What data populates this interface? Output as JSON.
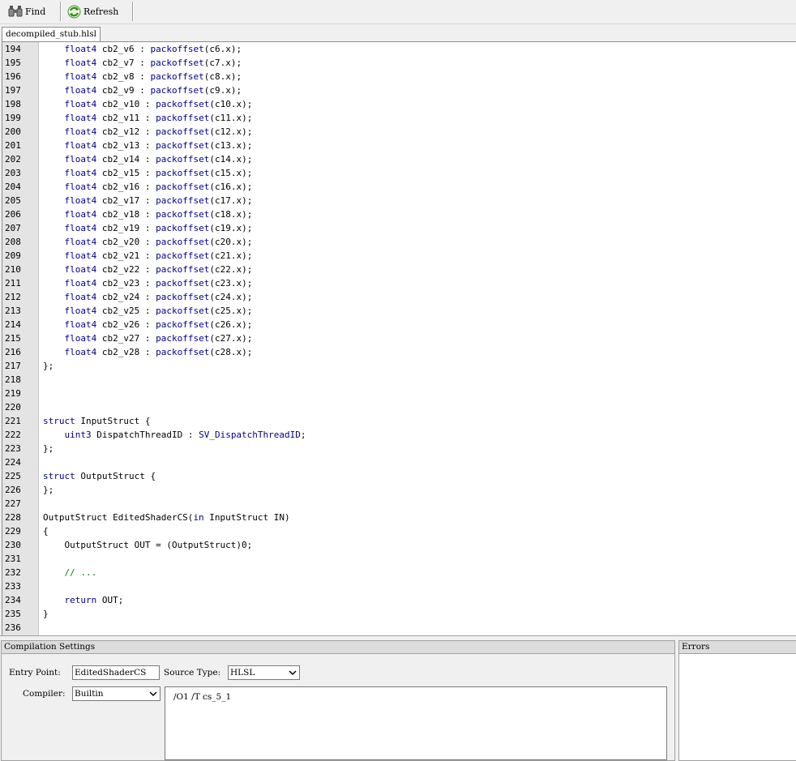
{
  "toolbar": {
    "find_label": "Find",
    "refresh_label": "Refresh"
  },
  "tabs": [
    {
      "label": "decompiled_stub.hlsl"
    }
  ],
  "editor": {
    "lines": [
      {
        "n": "194",
        "parts": [
          {
            "t": "    "
          },
          {
            "t": "float4",
            "c": "kw"
          },
          {
            "t": " cb2_v6 : "
          },
          {
            "t": "packoffset",
            "c": "kw"
          },
          {
            "t": "(c6.x);"
          }
        ]
      },
      {
        "n": "195",
        "parts": [
          {
            "t": "    "
          },
          {
            "t": "float4",
            "c": "kw"
          },
          {
            "t": " cb2_v7 : "
          },
          {
            "t": "packoffset",
            "c": "kw"
          },
          {
            "t": "(c7.x);"
          }
        ]
      },
      {
        "n": "196",
        "parts": [
          {
            "t": "    "
          },
          {
            "t": "float4",
            "c": "kw"
          },
          {
            "t": " cb2_v8 : "
          },
          {
            "t": "packoffset",
            "c": "kw"
          },
          {
            "t": "(c8.x);"
          }
        ]
      },
      {
        "n": "197",
        "parts": [
          {
            "t": "    "
          },
          {
            "t": "float4",
            "c": "kw"
          },
          {
            "t": " cb2_v9 : "
          },
          {
            "t": "packoffset",
            "c": "kw"
          },
          {
            "t": "(c9.x);"
          }
        ]
      },
      {
        "n": "198",
        "parts": [
          {
            "t": "    "
          },
          {
            "t": "float4",
            "c": "kw"
          },
          {
            "t": " cb2_v10 : "
          },
          {
            "t": "packoffset",
            "c": "kw"
          },
          {
            "t": "(c10.x);"
          }
        ]
      },
      {
        "n": "199",
        "parts": [
          {
            "t": "    "
          },
          {
            "t": "float4",
            "c": "kw"
          },
          {
            "t": " cb2_v11 : "
          },
          {
            "t": "packoffset",
            "c": "kw"
          },
          {
            "t": "(c11.x);"
          }
        ]
      },
      {
        "n": "200",
        "parts": [
          {
            "t": "    "
          },
          {
            "t": "float4",
            "c": "kw"
          },
          {
            "t": " cb2_v12 : "
          },
          {
            "t": "packoffset",
            "c": "kw"
          },
          {
            "t": "(c12.x);"
          }
        ]
      },
      {
        "n": "201",
        "parts": [
          {
            "t": "    "
          },
          {
            "t": "float4",
            "c": "kw"
          },
          {
            "t": " cb2_v13 : "
          },
          {
            "t": "packoffset",
            "c": "kw"
          },
          {
            "t": "(c13.x);"
          }
        ]
      },
      {
        "n": "202",
        "parts": [
          {
            "t": "    "
          },
          {
            "t": "float4",
            "c": "kw"
          },
          {
            "t": " cb2_v14 : "
          },
          {
            "t": "packoffset",
            "c": "kw"
          },
          {
            "t": "(c14.x);"
          }
        ]
      },
      {
        "n": "203",
        "parts": [
          {
            "t": "    "
          },
          {
            "t": "float4",
            "c": "kw"
          },
          {
            "t": " cb2_v15 : "
          },
          {
            "t": "packoffset",
            "c": "kw"
          },
          {
            "t": "(c15.x);"
          }
        ]
      },
      {
        "n": "204",
        "parts": [
          {
            "t": "    "
          },
          {
            "t": "float4",
            "c": "kw"
          },
          {
            "t": " cb2_v16 : "
          },
          {
            "t": "packoffset",
            "c": "kw"
          },
          {
            "t": "(c16.x);"
          }
        ]
      },
      {
        "n": "205",
        "parts": [
          {
            "t": "    "
          },
          {
            "t": "float4",
            "c": "kw"
          },
          {
            "t": " cb2_v17 : "
          },
          {
            "t": "packoffset",
            "c": "kw"
          },
          {
            "t": "(c17.x);"
          }
        ]
      },
      {
        "n": "206",
        "parts": [
          {
            "t": "    "
          },
          {
            "t": "float4",
            "c": "kw"
          },
          {
            "t": " cb2_v18 : "
          },
          {
            "t": "packoffset",
            "c": "kw"
          },
          {
            "t": "(c18.x);"
          }
        ]
      },
      {
        "n": "207",
        "parts": [
          {
            "t": "    "
          },
          {
            "t": "float4",
            "c": "kw"
          },
          {
            "t": " cb2_v19 : "
          },
          {
            "t": "packoffset",
            "c": "kw"
          },
          {
            "t": "(c19.x);"
          }
        ]
      },
      {
        "n": "208",
        "parts": [
          {
            "t": "    "
          },
          {
            "t": "float4",
            "c": "kw"
          },
          {
            "t": " cb2_v20 : "
          },
          {
            "t": "packoffset",
            "c": "kw"
          },
          {
            "t": "(c20.x);"
          }
        ]
      },
      {
        "n": "209",
        "parts": [
          {
            "t": "    "
          },
          {
            "t": "float4",
            "c": "kw"
          },
          {
            "t": " cb2_v21 : "
          },
          {
            "t": "packoffset",
            "c": "kw"
          },
          {
            "t": "(c21.x);"
          }
        ]
      },
      {
        "n": "210",
        "parts": [
          {
            "t": "    "
          },
          {
            "t": "float4",
            "c": "kw"
          },
          {
            "t": " cb2_v22 : "
          },
          {
            "t": "packoffset",
            "c": "kw"
          },
          {
            "t": "(c22.x);"
          }
        ]
      },
      {
        "n": "211",
        "parts": [
          {
            "t": "    "
          },
          {
            "t": "float4",
            "c": "kw"
          },
          {
            "t": " cb2_v23 : "
          },
          {
            "t": "packoffset",
            "c": "kw"
          },
          {
            "t": "(c23.x);"
          }
        ]
      },
      {
        "n": "212",
        "parts": [
          {
            "t": "    "
          },
          {
            "t": "float4",
            "c": "kw"
          },
          {
            "t": " cb2_v24 : "
          },
          {
            "t": "packoffset",
            "c": "kw"
          },
          {
            "t": "(c24.x);"
          }
        ]
      },
      {
        "n": "213",
        "parts": [
          {
            "t": "    "
          },
          {
            "t": "float4",
            "c": "kw"
          },
          {
            "t": " cb2_v25 : "
          },
          {
            "t": "packoffset",
            "c": "kw"
          },
          {
            "t": "(c25.x);"
          }
        ]
      },
      {
        "n": "214",
        "parts": [
          {
            "t": "    "
          },
          {
            "t": "float4",
            "c": "kw"
          },
          {
            "t": " cb2_v26 : "
          },
          {
            "t": "packoffset",
            "c": "kw"
          },
          {
            "t": "(c26.x);"
          }
        ]
      },
      {
        "n": "215",
        "parts": [
          {
            "t": "    "
          },
          {
            "t": "float4",
            "c": "kw"
          },
          {
            "t": " cb2_v27 : "
          },
          {
            "t": "packoffset",
            "c": "kw"
          },
          {
            "t": "(c27.x);"
          }
        ]
      },
      {
        "n": "216",
        "parts": [
          {
            "t": "    "
          },
          {
            "t": "float4",
            "c": "kw"
          },
          {
            "t": " cb2_v28 : "
          },
          {
            "t": "packoffset",
            "c": "kw"
          },
          {
            "t": "(c28.x);"
          }
        ]
      },
      {
        "n": "217",
        "parts": [
          {
            "t": "};"
          }
        ]
      },
      {
        "n": "218",
        "parts": []
      },
      {
        "n": "219",
        "parts": []
      },
      {
        "n": "220",
        "parts": []
      },
      {
        "n": "221",
        "parts": [
          {
            "t": "struct",
            "c": "kw"
          },
          {
            "t": " InputStruct {"
          }
        ]
      },
      {
        "n": "222",
        "parts": [
          {
            "t": "    "
          },
          {
            "t": "uint3",
            "c": "kw"
          },
          {
            "t": " DispatchThreadID : "
          },
          {
            "t": "SV_DispatchThreadID",
            "c": "kw"
          },
          {
            "t": ";"
          }
        ]
      },
      {
        "n": "223",
        "parts": [
          {
            "t": "};"
          }
        ]
      },
      {
        "n": "224",
        "parts": []
      },
      {
        "n": "225",
        "parts": [
          {
            "t": "struct",
            "c": "kw"
          },
          {
            "t": " OutputStruct {"
          }
        ]
      },
      {
        "n": "226",
        "parts": [
          {
            "t": "};"
          }
        ]
      },
      {
        "n": "227",
        "parts": []
      },
      {
        "n": "228",
        "parts": [
          {
            "t": "OutputStruct EditedShaderCS("
          },
          {
            "t": "in",
            "c": "kw"
          },
          {
            "t": " InputStruct IN)"
          }
        ]
      },
      {
        "n": "229",
        "parts": [
          {
            "t": "{"
          }
        ]
      },
      {
        "n": "230",
        "parts": [
          {
            "t": "    OutputStruct OUT = (OutputStruct)0;"
          }
        ]
      },
      {
        "n": "231",
        "parts": []
      },
      {
        "n": "232",
        "parts": [
          {
            "t": "    "
          },
          {
            "t": "// ...",
            "c": "cm"
          }
        ]
      },
      {
        "n": "233",
        "parts": []
      },
      {
        "n": "234",
        "parts": [
          {
            "t": "    "
          },
          {
            "t": "return",
            "c": "kw"
          },
          {
            "t": " OUT;"
          }
        ]
      },
      {
        "n": "235",
        "parts": [
          {
            "t": "}"
          }
        ]
      },
      {
        "n": "236",
        "parts": []
      }
    ]
  },
  "compilation": {
    "title": "Compilation Settings",
    "entry_point_label": "Entry Point:",
    "entry_point_value": "EditedShaderCS",
    "source_type_label": "Source Type:",
    "source_type_value": "HLSL",
    "compiler_label": "Compiler:",
    "compiler_value": "Builtin",
    "flags": "/O1 /T cs_5_1"
  },
  "errors": {
    "title": "Errors"
  },
  "colors": {
    "keyword": "#00008b",
    "comment": "#008000",
    "gutter": "#e4e4e4"
  }
}
